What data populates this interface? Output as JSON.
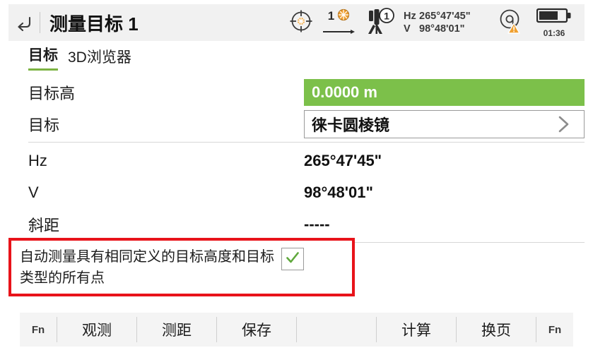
{
  "header": {
    "back_icon": "undo-back-arrow-icon",
    "title": "测量目标 1",
    "status": {
      "crosshair_icon": "target-crosshair-icon",
      "prism_count_icon": "prism-count-icon",
      "prism_count": "1",
      "tripod_icon": "instrument-tripod-icon",
      "tripod_badge": "1",
      "hz_label": "Hz",
      "hz_value": "265°47'45\"",
      "v_label": "V",
      "v_value": "98°48'01\"",
      "at_icon": "at-warning-icon",
      "battery_icon": "battery-icon",
      "battery_time": "01:36"
    }
  },
  "tabs": [
    {
      "label": "目标",
      "active": true
    },
    {
      "label": "3D浏览器",
      "active": false
    }
  ],
  "form": {
    "rows": [
      {
        "label": "目标高",
        "value": "0.0000 m",
        "kind": "green-field"
      },
      {
        "label": "目标",
        "value": "徕卡圆棱镜",
        "kind": "select-field",
        "chevron_icon": "chevron-right-icon"
      },
      {
        "label": "Hz",
        "value": "265°47'45\"",
        "kind": "text"
      },
      {
        "label": "V",
        "value": "98°48'01\"",
        "kind": "text"
      },
      {
        "label": "斜距",
        "value": "-----",
        "kind": "text"
      }
    ]
  },
  "option": {
    "text": "自动测量具有相同定义的目标高度和目标类型的所有点",
    "checked": true,
    "check_icon": "check-mark-icon",
    "annotation_color": "#e8131a"
  },
  "toolbar": {
    "left_fn": "Fn",
    "right_fn": "Fn",
    "buttons": [
      "观测",
      "测距",
      "保存",
      "",
      "计算",
      "换页"
    ]
  },
  "colors": {
    "accent_green": "#7cc04a",
    "tab_underline": "#7cb342",
    "annotation_red": "#e8131a",
    "header_bg": "#f1f1f1",
    "toolbar_bg": "#f4f4f4",
    "orange": "#f0a030"
  }
}
